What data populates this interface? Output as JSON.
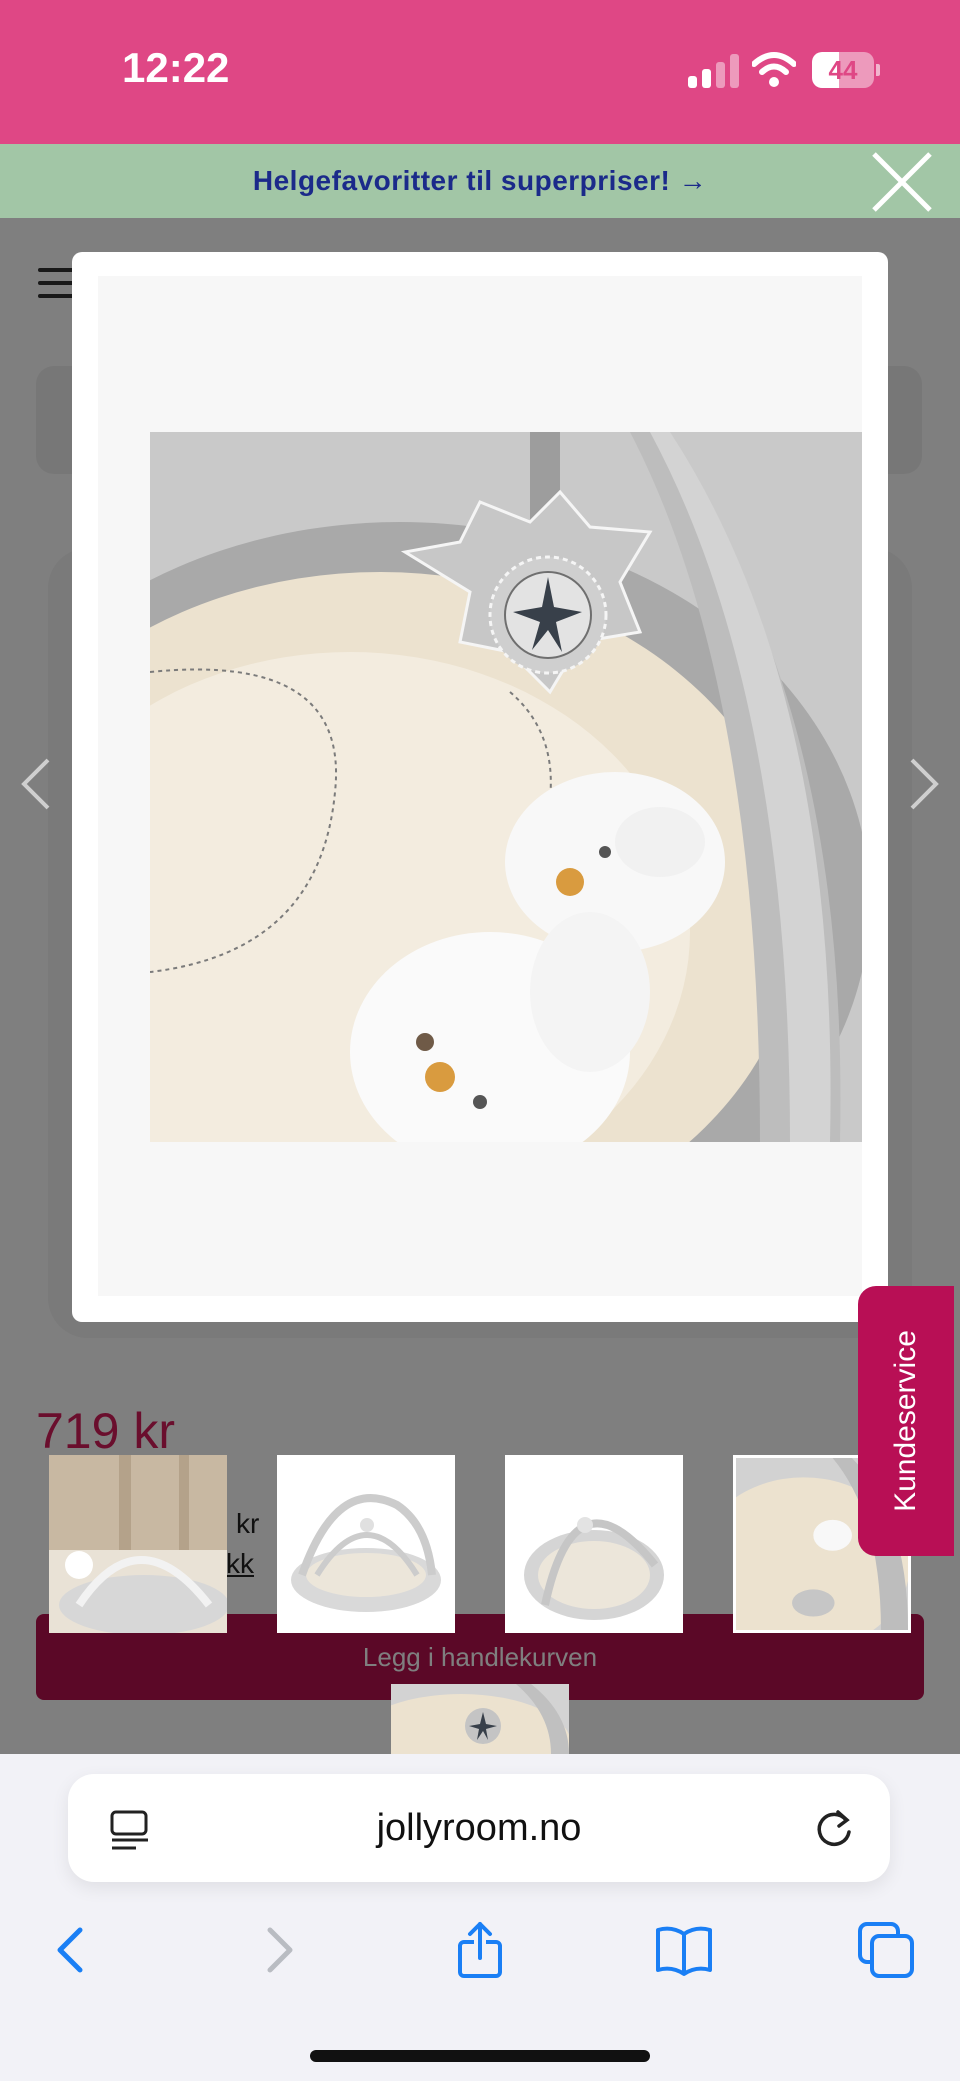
{
  "status_bar": {
    "time": "12:22",
    "battery_percent": "44",
    "battery_level": 0.44
  },
  "promo_banner": {
    "text": "Helgefavoritter til superpriser! →"
  },
  "product": {
    "price": "719 kr",
    "price_fragment": "kr",
    "link_fragment": "kk",
    "add_to_cart_label": "Legg i handlekurven"
  },
  "support_tab": {
    "label": "Kundeservice"
  },
  "browser": {
    "url": "jollyroom.no"
  },
  "icons": {
    "close": "close-icon",
    "prev": "chevron-left-icon",
    "next": "chevron-right-icon",
    "reader": "reader-icon",
    "reload": "reload-icon",
    "back": "back-icon",
    "forward": "forward-icon",
    "share": "share-icon",
    "bookmarks": "bookmarks-icon",
    "tabs": "tabs-icon"
  },
  "colors": {
    "brand_pink": "#df4785",
    "promo_green": "#a2c6a6",
    "promo_text": "#1b2a8a",
    "accent_magenta": "#b80f55",
    "safari_blue": "#1a7ff5"
  }
}
